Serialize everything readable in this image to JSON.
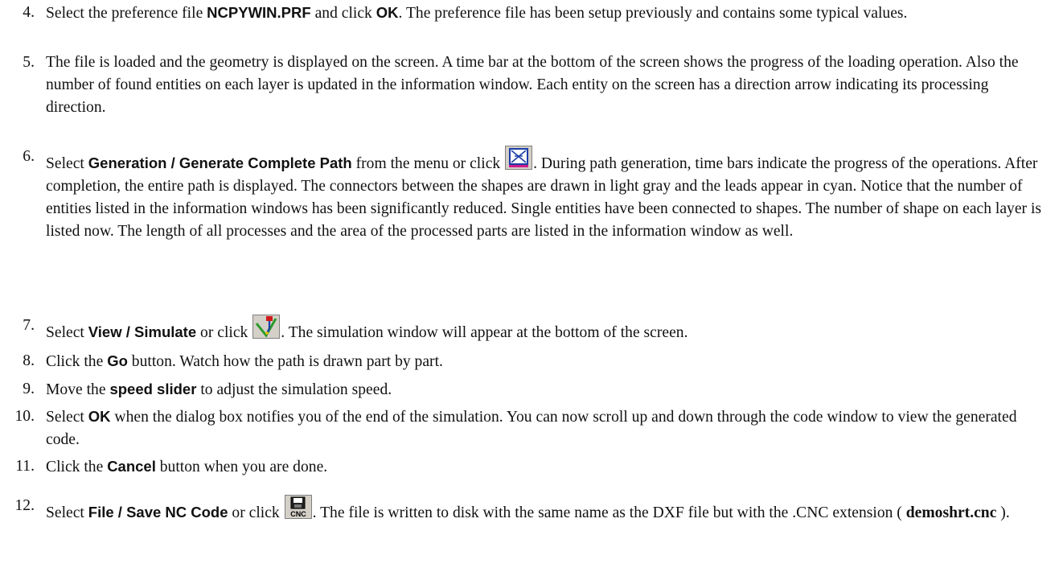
{
  "steps": [
    {
      "num": "4.",
      "parts": [
        {
          "t": "Select the preference file "
        },
        {
          "b": "NCPYWIN.PRF"
        },
        {
          "t": " and click "
        },
        {
          "b": "OK"
        },
        {
          "t": ". The preference file has been setup previously and contains some typical values."
        }
      ]
    },
    {
      "num": "5.",
      "parts": [
        {
          "t": "The file is loaded and the geometry is displayed on the screen. A time bar at the bottom of the screen shows the progress of the loading operation. Also the number of found entities on each layer is updated in the information window. Each entity on the screen has a direction arrow indicating its processing direction."
        }
      ]
    },
    {
      "num": "6.",
      "parts": [
        {
          "t": "Select "
        },
        {
          "b": "Generation / Generate Complete Path"
        },
        {
          "t": " from the menu or click "
        },
        {
          "icon": "generate-path-icon"
        },
        {
          "t": ". During path generation, time bars indicate the progress of the operations. After completion, the entire path is displayed. The connectors between the shapes are drawn in light gray and the leads appear in cyan. Notice that the number of entities listed in the information windows has been significantly reduced. Single entities have been connected to shapes. The number of shape on each layer is listed now. The length of all processes and the area of the processed parts are listed in the information window as well."
        }
      ]
    },
    {
      "num": "7.",
      "parts": [
        {
          "t": "Select "
        },
        {
          "b": "View / Simulate"
        },
        {
          "t": " or click "
        },
        {
          "icon": "simulate-icon"
        },
        {
          "t": ". The simulation window will appear at the bottom of the screen."
        }
      ]
    },
    {
      "num": "8.",
      "parts": [
        {
          "t": "Click the "
        },
        {
          "b": "Go"
        },
        {
          "t": " button. Watch how the path is drawn part by part."
        }
      ]
    },
    {
      "num": "9.",
      "parts": [
        {
          "t": "Move the "
        },
        {
          "b": "speed slider"
        },
        {
          "t": " to adjust the simulation speed."
        }
      ]
    },
    {
      "num": "10.",
      "parts": [
        {
          "t": "Select "
        },
        {
          "b": "OK"
        },
        {
          "t": " when the dialog box notifies you of the end of the simulation. You can now scroll up and down through the code window to view the generated code."
        }
      ]
    },
    {
      "num": "11.",
      "parts": [
        {
          "t": "Click the "
        },
        {
          "b": "Cancel"
        },
        {
          "t": " button when you are done."
        }
      ]
    },
    {
      "num": "12.",
      "parts": [
        {
          "t": "Select "
        },
        {
          "b": "File / Save NC Code"
        },
        {
          "t": " or click "
        },
        {
          "icon": "save-nc-code-icon"
        },
        {
          "t": ". The file is written to disk with the same name as the DXF file but with the .CNC extension ( "
        },
        {
          "bs": "demoshrt.cnc"
        },
        {
          "t": " )."
        }
      ]
    }
  ]
}
